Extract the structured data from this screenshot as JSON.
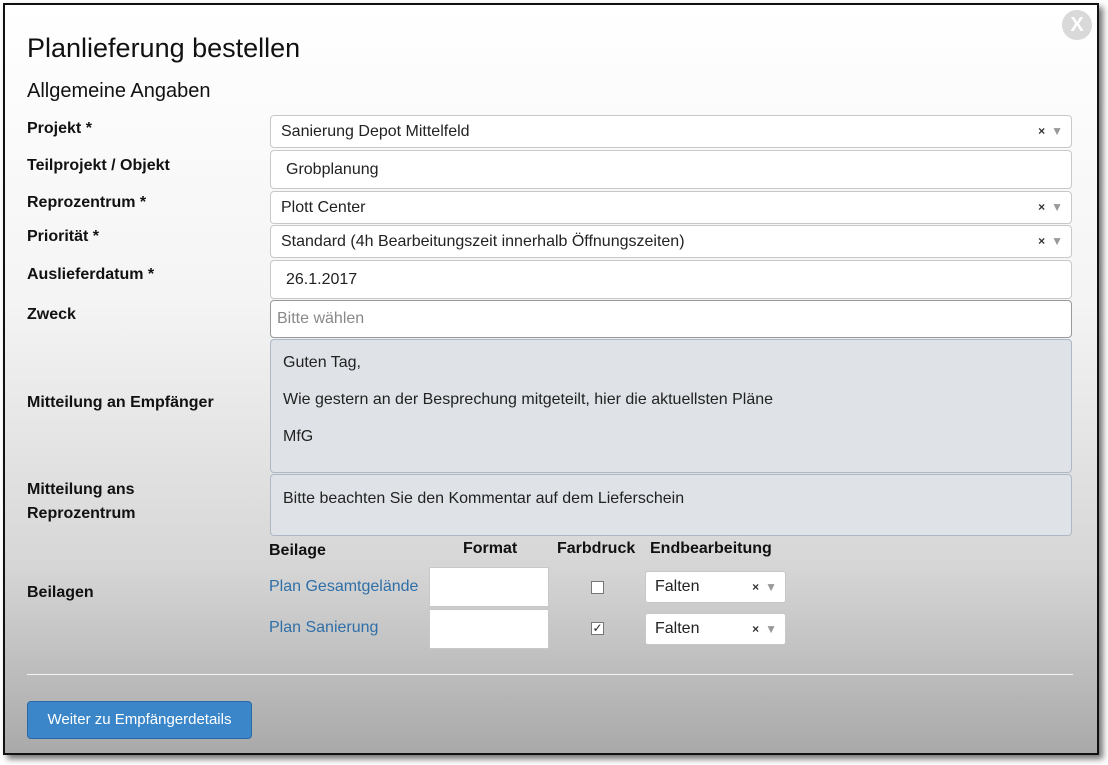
{
  "dialog": {
    "title": "Planlieferung bestellen",
    "close_label": "X",
    "section_title": "Allgemeine Angaben"
  },
  "form": {
    "projekt": {
      "label": "Projekt *",
      "value": "Sanierung Depot Mittelfeld"
    },
    "teilprojekt": {
      "label": "Teilprojekt / Objekt",
      "value": "Grobplanung"
    },
    "reprozentrum": {
      "label": "Reprozentrum *",
      "value": "Plott Center"
    },
    "prioritaet": {
      "label": "Priorität *",
      "value": "Standard (4h Bearbeitungszeit innerhalb Öffnungszeiten)"
    },
    "auslieferdatum": {
      "label": "Auslieferdatum *",
      "value": "26.1.2017"
    },
    "zweck": {
      "label": "Zweck",
      "placeholder": "Bitte wählen"
    },
    "mitteilung_empfaenger": {
      "label": "Mitteilung an Empfänger",
      "lines": [
        "Guten Tag,",
        "Wie gestern an der Besprechung mitgeteilt, hier die aktuellsten Pläne",
        "MfG"
      ]
    },
    "mitteilung_repro": {
      "label_line1": "Mitteilung ans",
      "label_line2": "Reprozentrum",
      "value": "Bitte beachten Sie den Kommentar auf dem Lieferschein"
    }
  },
  "select_clear": "×",
  "select_arrow": "▼",
  "beilagen": {
    "label": "Beilagen",
    "headers": {
      "beilage": "Beilage",
      "format": "Format",
      "farbdruck": "Farbdruck",
      "endbearbeitung": "Endbearbeitung"
    },
    "rows": [
      {
        "name": "Plan Gesamtgelände",
        "farbdruck": false,
        "endbearbeitung": "Falten"
      },
      {
        "name": "Plan Sanierung",
        "farbdruck": true,
        "endbearbeitung": "Falten"
      }
    ]
  },
  "footer": {
    "next_button": "Weiter zu Empfängerdetails"
  },
  "colors": {
    "link": "#2f6fa8",
    "primary_button": "#3a86c8"
  }
}
